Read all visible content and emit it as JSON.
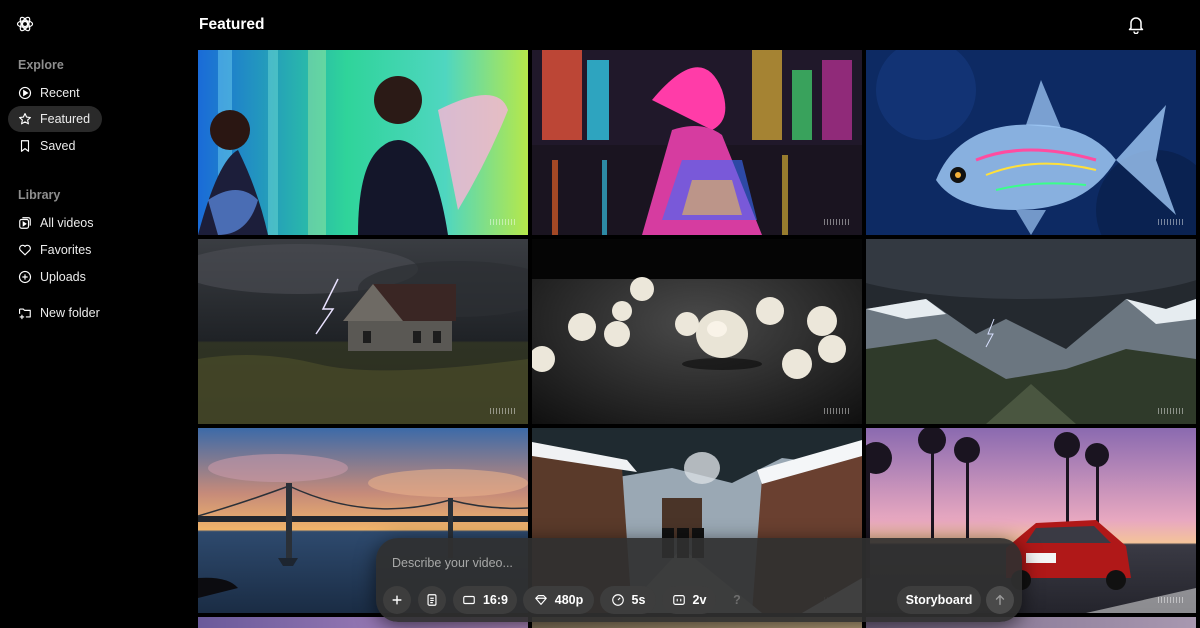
{
  "header": {
    "title": "Featured"
  },
  "sidebar": {
    "explore_label": "Explore",
    "library_label": "Library",
    "items": [
      {
        "label": "Recent",
        "icon": "play-circle-icon"
      },
      {
        "label": "Featured",
        "icon": "star-icon",
        "active": true
      },
      {
        "label": "Saved",
        "icon": "bookmark-icon"
      },
      {
        "label": "All videos",
        "icon": "video-library-icon"
      },
      {
        "label": "Favorites",
        "icon": "heart-icon"
      },
      {
        "label": "Uploads",
        "icon": "plus-circle-icon"
      },
      {
        "label": "New folder",
        "icon": "folder-plus-icon"
      }
    ]
  },
  "composer": {
    "placeholder": "Describe your video...",
    "aspect_ratio": "16:9",
    "resolution": "480p",
    "duration": "5s",
    "variations": "2v",
    "help": "?",
    "storyboard_label": "Storyboard"
  },
  "videos": [
    "neon-angel-dancers",
    "pink-dress-city-rain",
    "glowing-fish-underwater",
    "storm-house-field",
    "popcorn-closeup",
    "stormy-mountain-valley",
    "golden-gate-sunset",
    "snowy-village-street",
    "palm-road-red-car"
  ]
}
